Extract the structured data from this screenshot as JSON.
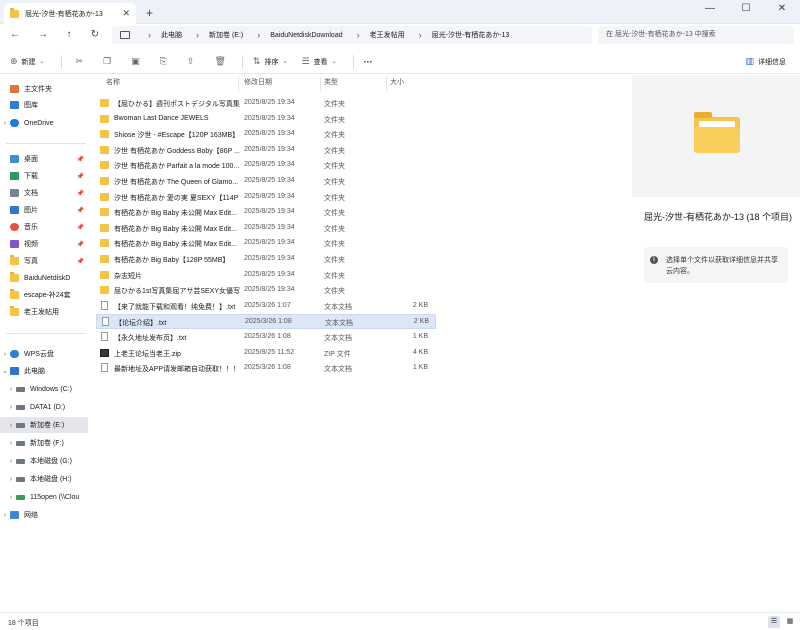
{
  "window": {
    "tab_title": "屈光-汐世-有栖花あか-13",
    "tab_close": "✕",
    "new_tab": "+",
    "minimize": "—",
    "maximize": "☐",
    "close": "✕"
  },
  "address": {
    "back": "←",
    "forward": "→",
    "up": "↑",
    "refresh": "↻",
    "breadcrumbs": [
      "此电脑",
      "新加卷 (E:)",
      "BaiduNetdiskDownload",
      "老王发帖用",
      "屈光-汐世-有栖花あか-13"
    ],
    "separator": "›",
    "search_placeholder": "在 屈光-汐世-有栖花あか-13 中搜索"
  },
  "toolbar": {
    "new_label": "新建",
    "sort_label": "排序",
    "view_label": "查看",
    "more_label": "···",
    "details_label": "详细信息"
  },
  "sidebar": {
    "items": [
      {
        "label": "主文件夹",
        "icon": "home-icon"
      },
      {
        "label": "图库",
        "icon": "gallery-icon"
      },
      {
        "label": "OneDrive",
        "icon": "cloud-icon"
      },
      {
        "label": "桌面",
        "icon": "desktop-icon"
      },
      {
        "label": "下载",
        "icon": "download-icon"
      },
      {
        "label": "文档",
        "icon": "documents-icon"
      },
      {
        "label": "图片",
        "icon": "pictures-icon"
      },
      {
        "label": "音乐",
        "icon": "music-icon"
      },
      {
        "label": "视频",
        "icon": "videos-icon"
      },
      {
        "label": "写真",
        "icon": "folder-icon"
      },
      {
        "label": "BaiduNetdiskD",
        "icon": "folder-icon"
      },
      {
        "label": "escape-补24套",
        "icon": "folder-icon"
      },
      {
        "label": "老王发帖用",
        "icon": "folder-icon"
      },
      {
        "label": "WPS云盘",
        "icon": "cloud-icon"
      },
      {
        "label": "此电脑",
        "icon": "computer-icon"
      },
      {
        "label": "Windows (C:)",
        "icon": "drive-icon"
      },
      {
        "label": "DATA1 (D:)",
        "icon": "drive-icon"
      },
      {
        "label": "新加卷 (E:)",
        "icon": "drive-icon"
      },
      {
        "label": "新加卷 (F:)",
        "icon": "drive-icon"
      },
      {
        "label": "本地磁盘 (G:)",
        "icon": "drive-icon"
      },
      {
        "label": "本地磁盘 (H:)",
        "icon": "drive-icon"
      },
      {
        "label": "115open (\\\\Clou",
        "icon": "network-drive-icon"
      },
      {
        "label": "网络",
        "icon": "network-icon"
      }
    ]
  },
  "columns": {
    "name": "名称",
    "date": "修改日期",
    "type": "类型",
    "size": "大小"
  },
  "files": [
    {
      "name": "【屈ひかる】週刊ポストデジタル写真集",
      "date": "2025/8/25 19:34",
      "type": "文件夹",
      "size": "",
      "kind": "folder"
    },
    {
      "name": "Bwoman Last Dance JEWELS",
      "date": "2025/8/25 19:34",
      "type": "文件夹",
      "size": "",
      "kind": "folder"
    },
    {
      "name": "Shiose 汐世 - #Escape【120P 163MB】",
      "date": "2025/8/25 19:34",
      "type": "文件夹",
      "size": "",
      "kind": "folder"
    },
    {
      "name": "汐世 有栖花あか Goddess Boby【86P ...",
      "date": "2025/8/25 19:34",
      "type": "文件夹",
      "size": "",
      "kind": "folder"
    },
    {
      "name": "汐世 有栖花あか Parfait a la mode 100...",
      "date": "2025/8/25 19:34",
      "type": "文件夹",
      "size": "",
      "kind": "folder"
    },
    {
      "name": "汐世 有栖花あか The Queen of Glamo...",
      "date": "2025/8/25 19:34",
      "type": "文件夹",
      "size": "",
      "kind": "folder"
    },
    {
      "name": "汐世 有栖花あか 愛の実 夏SEXY【114P ...",
      "date": "2025/8/25 19:34",
      "type": "文件夹",
      "size": "",
      "kind": "folder"
    },
    {
      "name": "有栖花あか  Big Baby 未公開 Max Edit...",
      "date": "2025/8/25 19:34",
      "type": "文件夹",
      "size": "",
      "kind": "folder"
    },
    {
      "name": "有栖花あか  Big Baby 未公開 Max Edit...",
      "date": "2025/8/25 19:34",
      "type": "文件夹",
      "size": "",
      "kind": "folder"
    },
    {
      "name": "有栖花あか  Big Baby 未公開 Max Edit...",
      "date": "2025/8/25 19:34",
      "type": "文件夹",
      "size": "",
      "kind": "folder"
    },
    {
      "name": "有栖花あか  Big Baby【128P 55MB】",
      "date": "2025/8/25 19:34",
      "type": "文件夹",
      "size": "",
      "kind": "folder"
    },
    {
      "name": "杂志短片",
      "date": "2025/8/25 19:34",
      "type": "文件夹",
      "size": "",
      "kind": "folder"
    },
    {
      "name": "屈ひかる1st写真集屈アサ芸SEXY女優写...",
      "date": "2025/8/25 19:34",
      "type": "文件夹",
      "size": "",
      "kind": "folder"
    },
    {
      "name": "【来了就能下载和观看！纯免费！】.txt",
      "date": "2025/3/26 1:07",
      "type": "文本文档",
      "size": "2 KB",
      "kind": "text"
    },
    {
      "name": "【论坛介绍】.txt",
      "date": "2025/3/26 1:08",
      "type": "文本文档",
      "size": "2 KB",
      "kind": "text"
    },
    {
      "name": "【永久地址发布页】.txt",
      "date": "2025/3/26 1:08",
      "type": "文本文档",
      "size": "1 KB",
      "kind": "text"
    },
    {
      "name": "上老王论坛当老王.zip",
      "date": "2025/8/25 11:52",
      "type": "ZIP 文件",
      "size": "4 KB",
      "kind": "zip"
    },
    {
      "name": "最新地址及APP请发邮箱自动获取！！！...",
      "date": "2025/3/26 1:08",
      "type": "文本文档",
      "size": "1 KB",
      "kind": "text"
    }
  ],
  "preview": {
    "title": "屈光-汐世-有栖花あか-13 (18 个项目)",
    "info": "选择单个文件以获取详细信息并共享云内容。"
  },
  "status": {
    "count": "18 个项目"
  }
}
